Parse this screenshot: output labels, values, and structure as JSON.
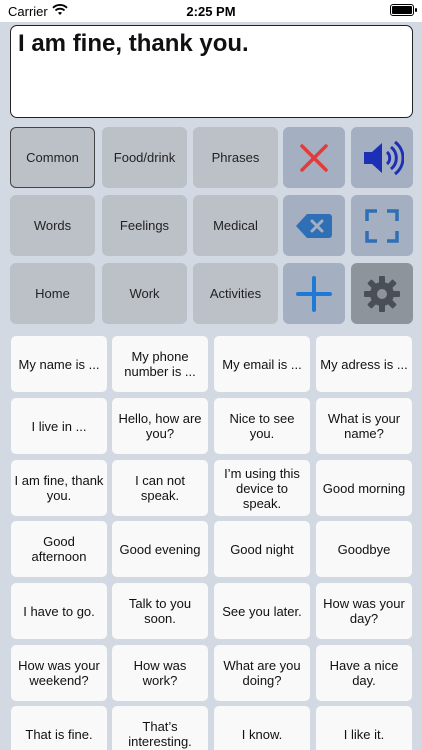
{
  "status": {
    "carrier": "Carrier",
    "time": "2:25 PM"
  },
  "text_area": {
    "value": "I am fine, thank you."
  },
  "categories": [
    {
      "label": "Common",
      "selected": true
    },
    {
      "label": "Food/drink"
    },
    {
      "label": "Phrases"
    },
    {
      "label": "Words"
    },
    {
      "label": "Feelings"
    },
    {
      "label": "Medical"
    },
    {
      "label": "Home"
    },
    {
      "label": "Work"
    },
    {
      "label": "Activities"
    }
  ],
  "tools": [
    {
      "icon": "close-icon",
      "color": "#e23b3b"
    },
    {
      "icon": "speaker-icon",
      "color": "#1c2fb5"
    },
    {
      "icon": "backspace-icon",
      "color": "#2f6fb6"
    },
    {
      "icon": "fullscreen-icon",
      "color": "#2f6fb6"
    },
    {
      "icon": "add-icon",
      "color": "#1f7ad6"
    },
    {
      "icon": "gear-icon",
      "color": "#4a4f55"
    }
  ],
  "phrases": [
    "My name is ...",
    "My phone number is ...",
    "My email is ...",
    "My adress is ...",
    "I live in ...",
    "Hello, how are you?",
    "Nice to see you.",
    "What is your name?",
    "I am fine, thank you.",
    "I can not speak.",
    "I’m using this device to speak.",
    "Good morning",
    "Good afternoon",
    "Good evening",
    "Good night",
    "Goodbye",
    "I have to go.",
    "Talk to you soon.",
    "See you later.",
    "How was your day?",
    "How was your weekend?",
    "How was work?",
    "What are you doing?",
    "Have a nice day.",
    "That is fine.",
    "That’s interesting.",
    "I know.",
    "I like it."
  ]
}
